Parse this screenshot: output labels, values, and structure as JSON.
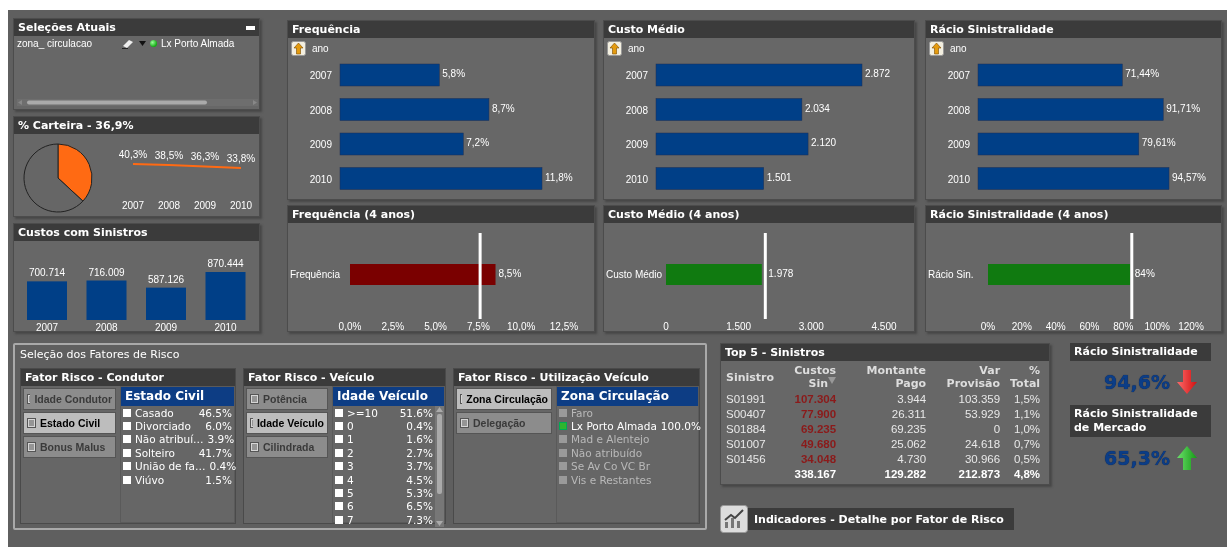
{
  "current_selections": {
    "title": "Seleções Atuais",
    "items": [
      {
        "field": "zona_ circulacao",
        "value": "Lx Porto Almada"
      }
    ]
  },
  "carteira": {
    "title": "% Carteira - 36,9%",
    "pie_chart": {
      "chart_data": {
        "type": "pie",
        "values": [
          36.9,
          63.1
        ]
      }
    },
    "trend_chart": {
      "chart_data": {
        "type": "line",
        "categories": [
          "2007",
          "2008",
          "2009",
          "2010"
        ],
        "values": [
          40.3,
          38.5,
          36.3,
          33.8
        ],
        "data_labels": true,
        "value_labels": [
          "40,3%",
          "38,5%",
          "36,3%",
          "33,8%"
        ]
      }
    }
  },
  "costs": {
    "title": "Custos com Sinistros",
    "chart_data": {
      "type": "bar",
      "categories": [
        "2007",
        "2008",
        "2009",
        "2010"
      ],
      "values": [
        700714,
        716009,
        587126,
        870444
      ],
      "data_labels": true,
      "value_labels": [
        "700.714",
        "716.009",
        "587.126",
        "870.444"
      ]
    }
  },
  "year_charts": [
    {
      "title": "Frequência",
      "drill_label": "ano",
      "chart_data": {
        "type": "bar",
        "orientation": "horizontal",
        "categories": [
          "2007",
          "2008",
          "2009",
          "2010"
        ],
        "values": [
          5.8,
          8.7,
          7.2,
          11.8
        ],
        "data_labels": true,
        "value_labels": [
          "5,8%",
          "8,7%",
          "7,2%",
          "11,8%"
        ]
      }
    },
    {
      "title": "Custo Médio",
      "drill_label": "ano",
      "chart_data": {
        "type": "bar",
        "orientation": "horizontal",
        "categories": [
          "2007",
          "2008",
          "2009",
          "2010"
        ],
        "values": [
          2872,
          2034,
          2120,
          1501
        ],
        "data_labels": true,
        "value_labels": [
          "2.872",
          "2.034",
          "2.120",
          "1.501"
        ]
      }
    },
    {
      "title": "Rácio Sinistralidade",
      "drill_label": "ano",
      "chart_data": {
        "type": "bar",
        "orientation": "horizontal",
        "categories": [
          "2007",
          "2008",
          "2009",
          "2010"
        ],
        "values": [
          71.44,
          91.71,
          79.61,
          94.57
        ],
        "data_labels": true,
        "value_labels": [
          "71,44%",
          "91,71%",
          "79,61%",
          "94,57%"
        ]
      }
    }
  ],
  "overall_charts": [
    {
      "title": "Frequência (4 anos)",
      "color": "#7a0000",
      "chart_data": {
        "type": "bar",
        "orientation": "horizontal",
        "categories": [
          "Frequência"
        ],
        "values": [
          8.5
        ],
        "data_labels": true,
        "value_labels": [
          "8,5%"
        ],
        "xlim": [
          0,
          12.5
        ],
        "xticks": [
          {
            "value": 0,
            "label": "0,0%"
          },
          {
            "value": 2.5,
            "label": "2,5%"
          },
          {
            "value": 5,
            "label": "5,0%"
          },
          {
            "value": 7.5,
            "label": "7,5%"
          },
          {
            "value": 10,
            "label": "10,0%"
          },
          {
            "value": 12.5,
            "label": "12,5%"
          }
        ],
        "ref_lines": [
          {
            "axis": "x",
            "value": 7.6
          }
        ]
      }
    },
    {
      "title": "Custo Médio (4 anos)",
      "color": "#107a10",
      "chart_data": {
        "type": "bar",
        "orientation": "horizontal",
        "categories": [
          "Custo Médio"
        ],
        "values": [
          1978
        ],
        "data_labels": true,
        "value_labels": [
          "1.978"
        ],
        "xlim": [
          0,
          4500
        ],
        "xticks": [
          {
            "value": 0,
            "label": "0"
          },
          {
            "value": 1500,
            "label": "1.500"
          },
          {
            "value": 3000,
            "label": "3.000"
          },
          {
            "value": 4500,
            "label": "4.500"
          }
        ],
        "ref_lines": [
          {
            "axis": "x",
            "value": 2050
          }
        ]
      }
    },
    {
      "title": "Rácio Sinistralidade (4 anos)",
      "color": "#107a10",
      "chart_data": {
        "type": "bar",
        "orientation": "horizontal",
        "categories": [
          "Rácio Sin."
        ],
        "values": [
          84
        ],
        "data_labels": true,
        "value_labels": [
          "84%"
        ],
        "xlim": [
          0,
          120
        ],
        "xticks": [
          {
            "value": 0,
            "label": "0%"
          },
          {
            "value": 20,
            "label": "20%"
          },
          {
            "value": 40,
            "label": "40%"
          },
          {
            "value": 60,
            "label": "60%"
          },
          {
            "value": 80,
            "label": "80%"
          },
          {
            "value": 100,
            "label": "100%"
          },
          {
            "value": 120,
            "label": "120%"
          }
        ],
        "ref_lines": [
          {
            "axis": "x",
            "value": 85
          }
        ]
      }
    }
  ],
  "risk_factors": {
    "title": "Seleção dos Fatores de Risco",
    "groups": [
      {
        "title": "Fator Risco - Condutor",
        "tabs": [
          {
            "label": "Idade Condutor",
            "selected": false
          },
          {
            "label": "Estado Civil",
            "selected": true
          },
          {
            "label": "Bonus Malus",
            "selected": false
          }
        ],
        "list": {
          "title": "Estado Civil",
          "scrollbar": false,
          "items": [
            {
              "label": "Casado",
              "share": "46.5%",
              "selected": false,
              "excluded": false
            },
            {
              "label": "Divorciado",
              "share": "6.0%",
              "selected": false,
              "excluded": false
            },
            {
              "label": "Não atribuí…",
              "share": "3.9%",
              "selected": false,
              "excluded": false
            },
            {
              "label": "Solteiro",
              "share": "41.7%",
              "selected": false,
              "excluded": false
            },
            {
              "label": "União de fa…",
              "share": "0.4%",
              "selected": false,
              "excluded": false
            },
            {
              "label": "Viúvo",
              "share": "1.5%",
              "selected": false,
              "excluded": false
            }
          ]
        }
      },
      {
        "title": "Fator Risco - Veículo",
        "tabs": [
          {
            "label": "Potência",
            "selected": false
          },
          {
            "label": "Idade Veículo",
            "selected": true
          },
          {
            "label": "Cilindrada",
            "selected": false
          }
        ],
        "list": {
          "title": "Idade Veículo",
          "scrollbar": true,
          "items": [
            {
              "label": ">=10",
              "share": "51.6%",
              "selected": false,
              "excluded": false
            },
            {
              "label": "0",
              "share": "0.4%",
              "selected": false,
              "excluded": false
            },
            {
              "label": "1",
              "share": "1.6%",
              "selected": false,
              "excluded": false
            },
            {
              "label": "2",
              "share": "2.7%",
              "selected": false,
              "excluded": false
            },
            {
              "label": "3",
              "share": "3.7%",
              "selected": false,
              "excluded": false
            },
            {
              "label": "4",
              "share": "4.5%",
              "selected": false,
              "excluded": false
            },
            {
              "label": "5",
              "share": "5.3%",
              "selected": false,
              "excluded": false
            },
            {
              "label": "6",
              "share": "6.5%",
              "selected": false,
              "excluded": false
            },
            {
              "label": "7",
              "share": "7.3%",
              "selected": false,
              "excluded": false
            }
          ]
        }
      },
      {
        "title": "Fator Risco - Utilização Veículo",
        "tabs": [
          {
            "label": "Zona Circulação",
            "selected": true
          },
          {
            "label": "Delegação",
            "selected": false
          }
        ],
        "list": {
          "title": "Zona Circulação",
          "scrollbar": false,
          "items": [
            {
              "label": "Faro",
              "selected": false,
              "excluded": true
            },
            {
              "label": "Lx Porto Almada",
              "share": "100.0%",
              "selected": true,
              "excluded": false
            },
            {
              "label": "Mad e Alentejo",
              "selected": false,
              "excluded": true
            },
            {
              "label": "Não atribuído",
              "selected": false,
              "excluded": true
            },
            {
              "label": "Se Av Co VC Br",
              "selected": false,
              "excluded": true
            },
            {
              "label": "Vis e Restantes",
              "selected": false,
              "excluded": true
            }
          ]
        }
      }
    ]
  },
  "top5": {
    "title": "Top 5 - Sinistros",
    "columns": [
      {
        "label": "Sinistro",
        "sorted": false,
        "color": "#e8e8e8"
      },
      {
        "label": "Custos Sin",
        "sorted": true,
        "color": "#8b1a1a"
      },
      {
        "label": "Montante Pago",
        "sorted": false,
        "color": "#e8e8e8"
      },
      {
        "label": "Var Provisão",
        "sorted": false,
        "color": "#e8e8e8"
      },
      {
        "label": "% Total",
        "sorted": false,
        "color": "#e8e8e8"
      }
    ],
    "rows": [
      [
        "S01991",
        "107.304",
        "3.944",
        "103.359",
        "1,5%"
      ],
      [
        "S00407",
        "77.900",
        "26.311",
        "53.929",
        "1,1%"
      ],
      [
        "S01884",
        "69.235",
        "69.235",
        "0",
        "1,0%"
      ],
      [
        "S01007",
        "49.680",
        "25.062",
        "24.618",
        "0,7%"
      ],
      [
        "S01456",
        "34.048",
        "4.730",
        "30.966",
        "0,5%"
      ]
    ],
    "totals": [
      "338.167",
      "129.282",
      "212.873",
      "4,8%"
    ]
  },
  "kpis": [
    {
      "title": "Rácio Sinistralidade",
      "value": "94,6%",
      "kind": "down"
    },
    {
      "title": "Rácio Sinistralidade de Mercado",
      "value": "65,3%",
      "kind": "up"
    }
  ],
  "report_button": {
    "label": "Indicadores - Detalhe por Fator de Risco"
  }
}
